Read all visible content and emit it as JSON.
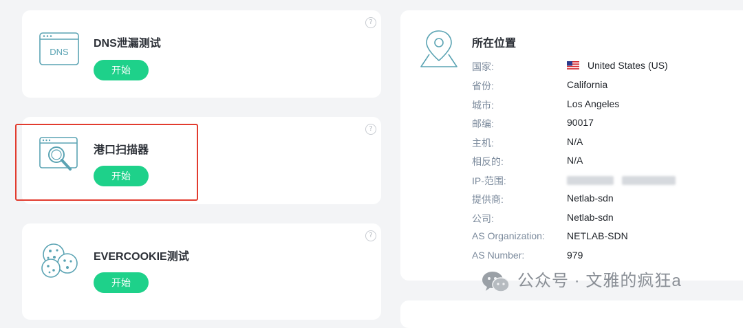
{
  "tests": [
    {
      "title": "DNS泄漏测试",
      "button": "开始",
      "icon": "dns-icon",
      "icon_text": "DNS"
    },
    {
      "title": "港口扫描器",
      "button": "开始",
      "icon": "port-scanner-icon"
    },
    {
      "title": "EVERCOOKIE测试",
      "button": "开始",
      "icon": "cookies-icon"
    }
  ],
  "help_glyph": "?",
  "location": {
    "title": "所在位置",
    "icon": "map-pin-icon",
    "rows": [
      {
        "label": "国家:",
        "value": "United States (US)",
        "icon": "us-flag-icon"
      },
      {
        "label": "省份:",
        "value": "California"
      },
      {
        "label": "城市:",
        "value": "Los Angeles"
      },
      {
        "label": "邮编:",
        "value": "90017"
      },
      {
        "label": "主机:",
        "value": "N/A"
      },
      {
        "label": "相反的:",
        "value": "N/A"
      },
      {
        "label": "IP-范围:",
        "value": "",
        "redacted": true
      },
      {
        "label": "提供商:",
        "value": "Netlab-sdn"
      },
      {
        "label": "公司:",
        "value": "Netlab-sdn"
      },
      {
        "label": "AS Organization:",
        "value": "NETLAB-SDN"
      },
      {
        "label": "AS Number:",
        "value": "979"
      }
    ]
  },
  "watermark": "公众号 · 文雅的疯狂a",
  "colors": {
    "accent": "#1ed18a",
    "highlight": "#e23b2e",
    "icon": "#5aa3b3",
    "label": "#7b8a9c"
  }
}
